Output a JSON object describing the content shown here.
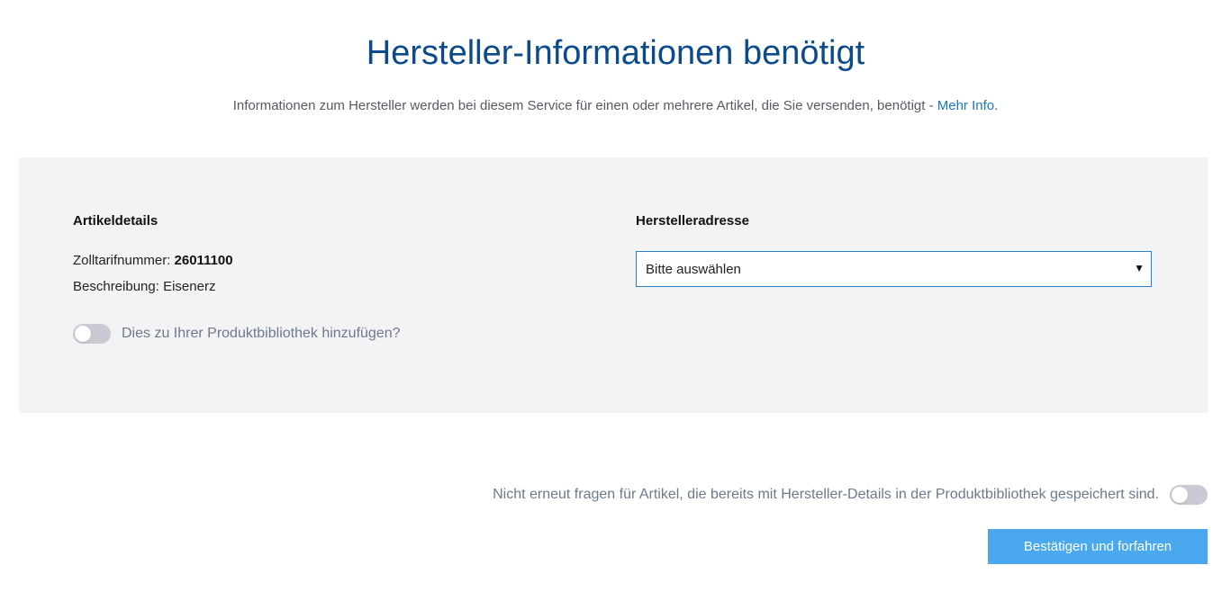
{
  "header": {
    "title": "Hersteller-Informationen benötigt",
    "subtitle": "Informationen zum Hersteller werden bei diesem Service für einen oder mehrere Artikel, die Sie versenden, benötigt - ",
    "more_info_link": "Mehr Info",
    "subtitle_end": "."
  },
  "article": {
    "heading": "Artikeldetails",
    "tariff_label": "Zolltarifnummer: ",
    "tariff_value": "26011100",
    "description_label": "Beschreibung: ",
    "description_value": "Eisenerz",
    "library_toggle_label": "Dies zu Ihrer Produktbibliothek hinzufügen?",
    "library_toggle_on": false
  },
  "manufacturer": {
    "heading": "Herstelleradresse",
    "select_value": "Bitte auswählen"
  },
  "footer": {
    "dont_ask_label": "Nicht erneut fragen für Artikel, die bereits mit Hersteller-Details in der Produktbibliothek gespeichert sind.",
    "dont_ask_toggle_on": false,
    "confirm_button": "Bestätigen und forfahren"
  },
  "colors": {
    "title": "#0b4a8b",
    "link": "#1a78c2",
    "panel_bg": "#f3f3f6",
    "select_border": "#2b7fc6",
    "button_bg": "#4aa9ee",
    "toggle_off": "#c9cad3"
  },
  "icons": {
    "select_arrow": "caret-down-icon"
  }
}
